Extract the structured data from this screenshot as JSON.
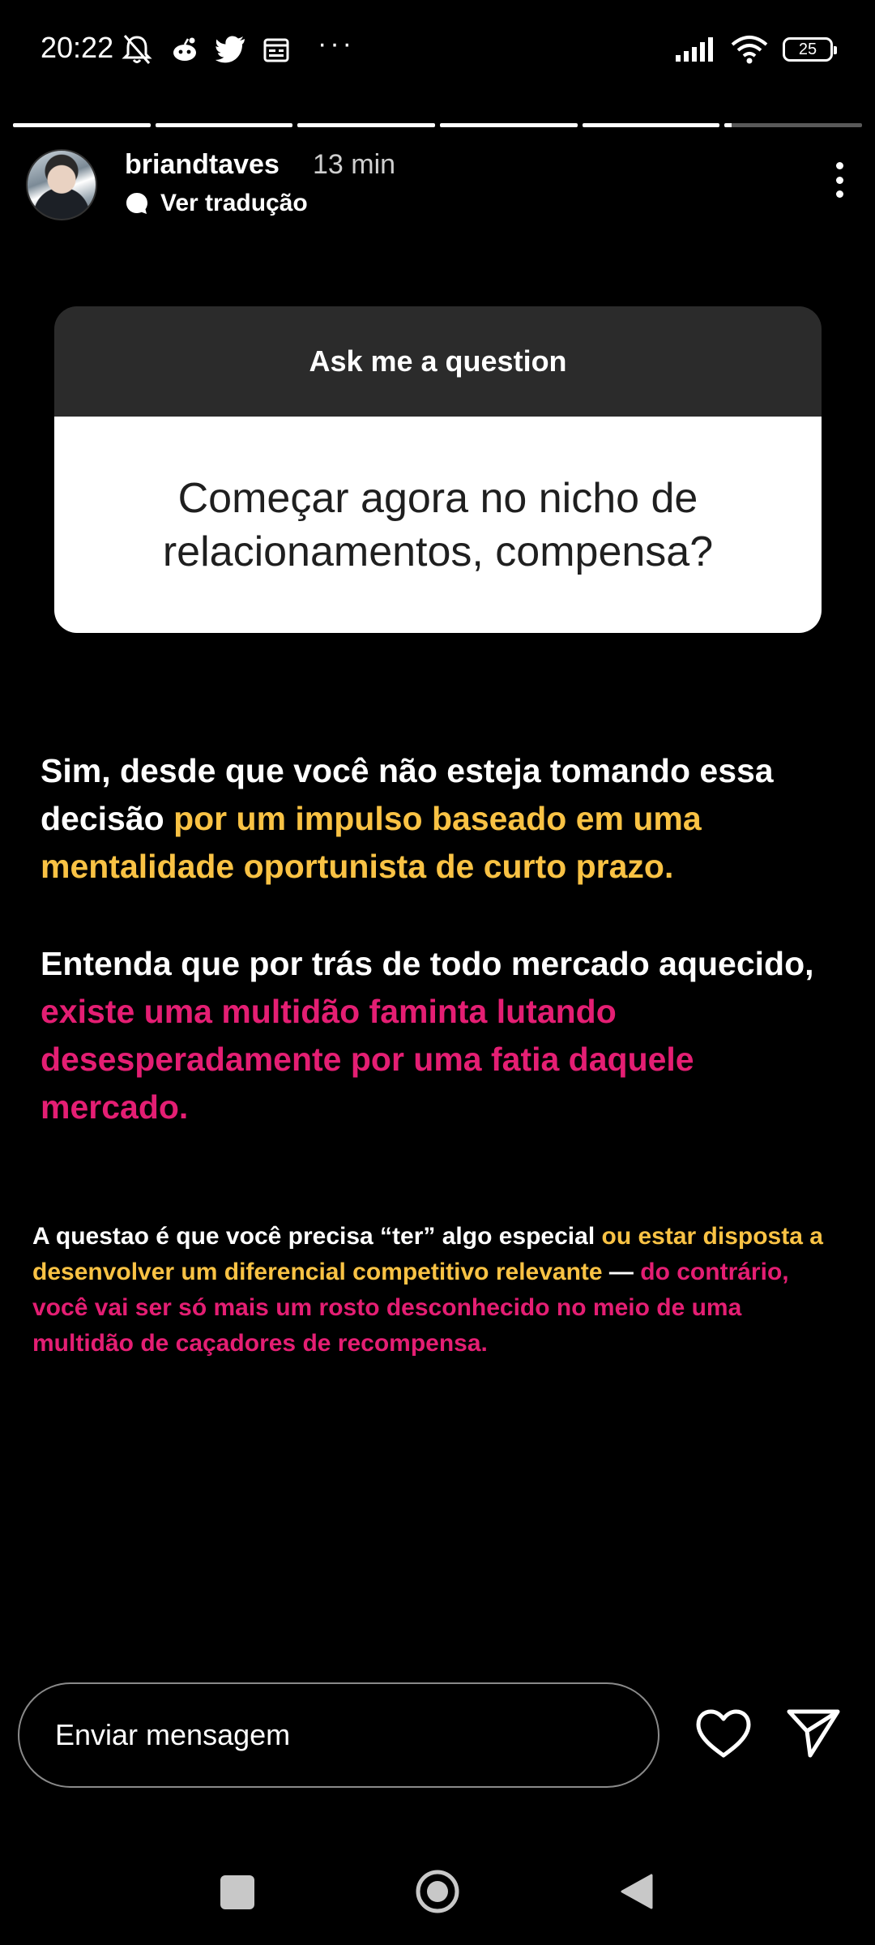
{
  "status_bar": {
    "time": "20:22",
    "battery": "25",
    "left_icons": [
      "mute-bell-icon",
      "reddit-icon",
      "twitter-icon",
      "calendar-icon"
    ],
    "overflow": "···",
    "right_icons": [
      "signal-icon",
      "wifi-icon",
      "battery-icon"
    ]
  },
  "story": {
    "segments_total": 6,
    "segments_completed": 5,
    "current_segment_progress": 0.05,
    "username": "briandtaves",
    "time_ago": "13 min",
    "translate_label": "Ver tradução"
  },
  "question_sticker": {
    "header": "Ask me a question",
    "question": "Começar agora no nicho de relacionamentos, compensa?"
  },
  "answer_1": {
    "white": "Sim, desde que você não esteja tomando essa decisão ",
    "yellow": "por um impulso baseado em uma mentalidade oportunista de curto prazo."
  },
  "answer_2": {
    "white": "Entenda que por trás de todo mercado aquecido, ",
    "pink": "existe uma multidão faminta lutando desesperadamente por uma fatia daquele mercado."
  },
  "answer_3": {
    "white_1": "A questao é que você precisa “ter” algo especial ",
    "yellow": "ou estar disposta a desenvolver um diferencial competitivo relevante",
    "white_2": " — ",
    "pink": "do contrário, você vai ser só mais um rosto desconhecido no meio de uma multidão de caçadores de recompensa."
  },
  "reply_bar": {
    "placeholder": "Enviar mensagem"
  },
  "colors": {
    "yellow": "#f9c244",
    "pink": "#e41e73",
    "background": "#000000"
  }
}
